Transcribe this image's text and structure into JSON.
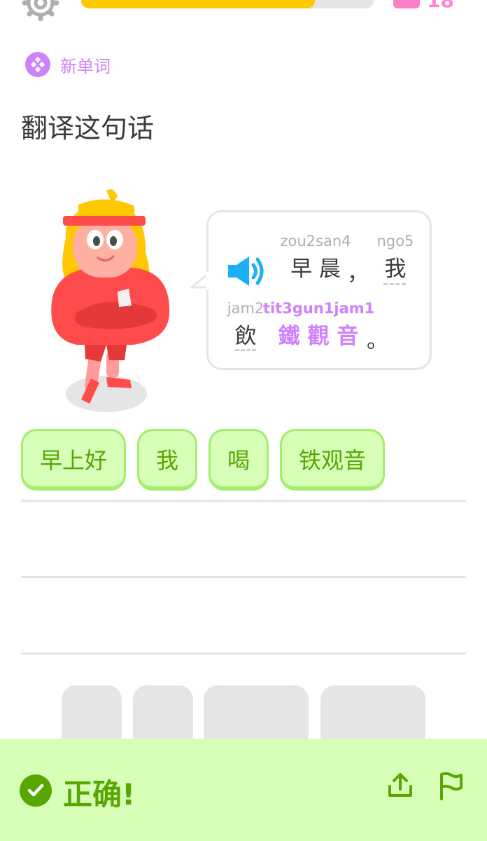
{
  "header": {
    "progress_fraction": 0.8,
    "streak_count": "18"
  },
  "badge": {
    "label": "新单词"
  },
  "instruction": "翻译这句话",
  "prompt": {
    "tokens": [
      {
        "rom": "zou2san4",
        "chars": "早 晨"
      },
      {
        "rom": "",
        "chars": "，"
      },
      {
        "rom": "ngo5",
        "chars": "我"
      },
      {
        "rom": "jam2",
        "chars": "飲"
      },
      {
        "rom": "tit3gun1jam1",
        "chars": "鐵 觀 音"
      },
      {
        "rom": "",
        "chars": "。"
      }
    ]
  },
  "answer_chips": [
    {
      "label": "早上好"
    },
    {
      "label": "我"
    },
    {
      "label": "喝"
    },
    {
      "label": "铁观音"
    }
  ],
  "feedback": {
    "result": "正确!"
  },
  "colors": {
    "green": "#58a700",
    "light_green": "#d7ffb8",
    "purple": "#ce82ff",
    "yellow": "#ffc800"
  }
}
